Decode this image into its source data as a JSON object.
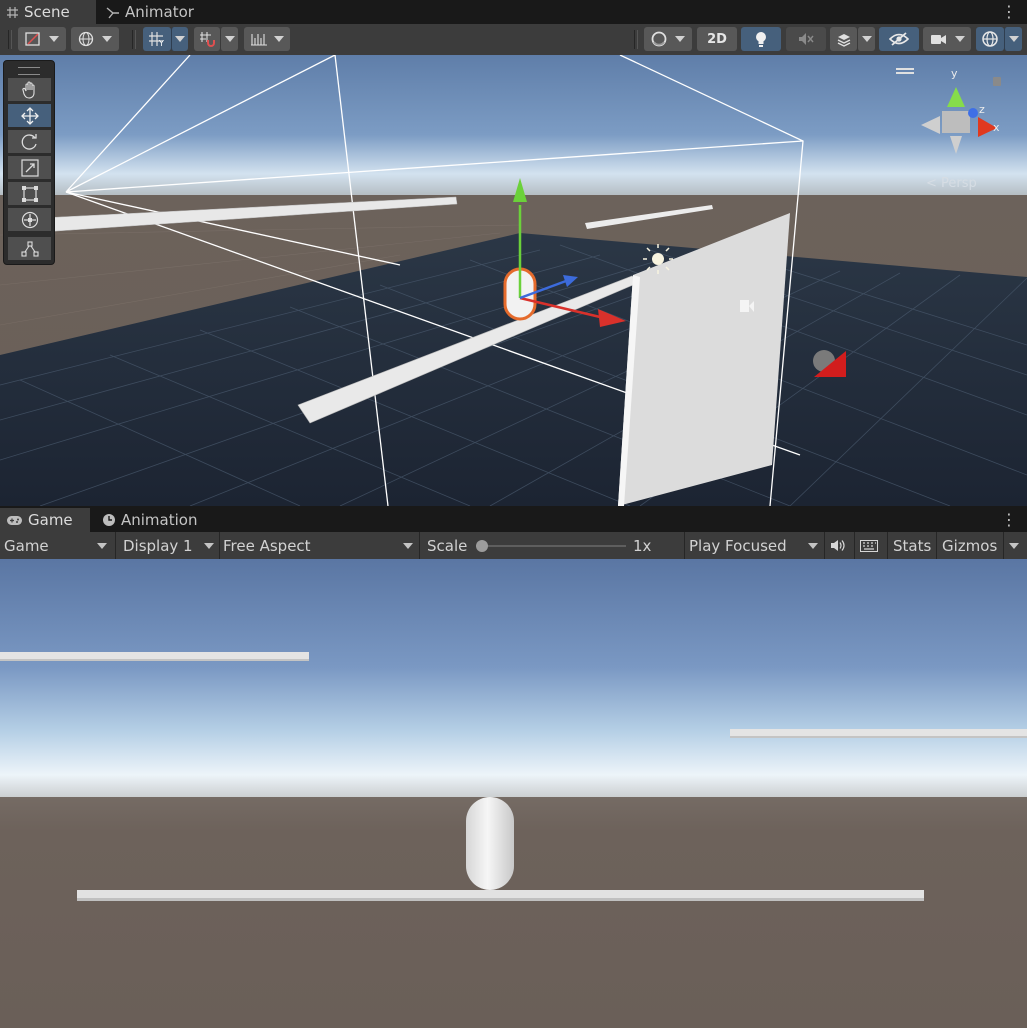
{
  "scene_tabs": [
    {
      "label": "Scene",
      "icon": "hash-icon",
      "active": true
    },
    {
      "label": "Animator",
      "icon": "animator-icon",
      "active": false
    }
  ],
  "scene_toolbar": {
    "mode_2d_label": "2D"
  },
  "gizmo": {
    "axis_y": "y",
    "axis_x": "x",
    "axis_z": "z",
    "projection_label": "< Persp"
  },
  "tools": [
    "hand-tool",
    "move-tool",
    "rotate-tool",
    "scale-tool",
    "rect-tool",
    "transform-tool",
    "custom-tool"
  ],
  "selected_tool": "move-tool",
  "game_tabs": [
    {
      "label": "Game",
      "icon": "gamepad-icon",
      "active": true
    },
    {
      "label": "Animation",
      "icon": "clock-icon",
      "active": false
    }
  ],
  "game_toolbar": {
    "view_select": "Game",
    "display_select": "Display 1",
    "aspect_select": "Free Aspect",
    "scale_label": "Scale",
    "scale_value": "1x",
    "scale_fraction": 0.0,
    "play_mode_select": "Play Focused",
    "stats_label": "Stats",
    "gizmos_label": "Gizmos"
  },
  "colors": {
    "accent_selected": "#46607c",
    "panel_bg": "#3c3c3c",
    "tab_bg": "#191919",
    "sky_top": "#5d79a6",
    "ground": "#6b6058"
  }
}
